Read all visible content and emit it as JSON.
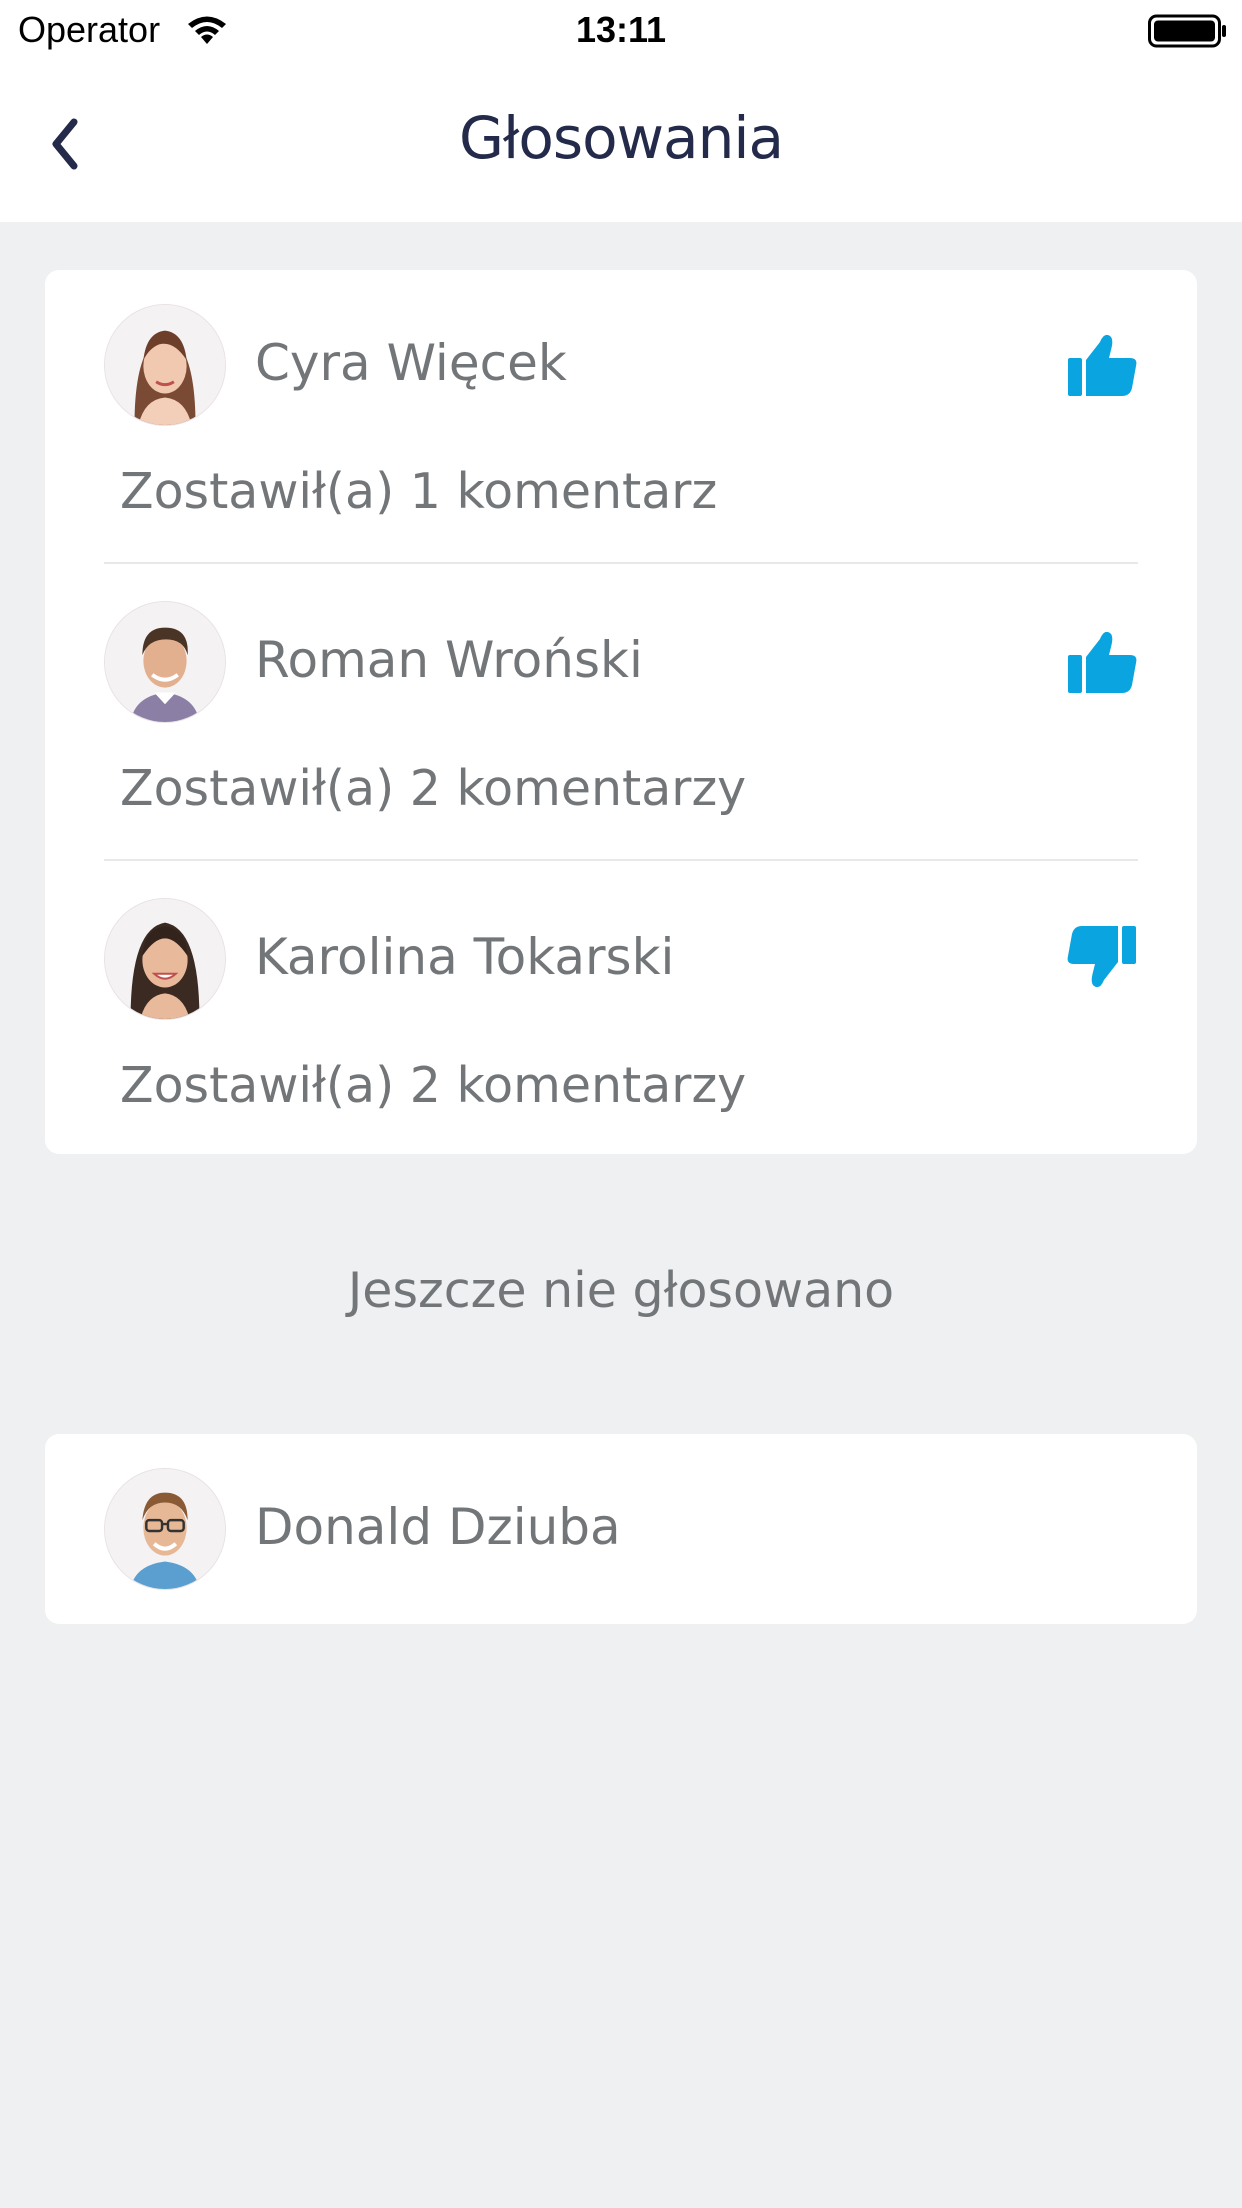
{
  "status_bar": {
    "carrier": "Operator",
    "time": "13:11"
  },
  "nav": {
    "title": "Głosowania"
  },
  "voted": [
    {
      "name": "Cyra Więcek",
      "comment": "Zostawił(a) 1 komentarz",
      "vote": "up",
      "avatar": "woman-long-hair"
    },
    {
      "name": "Roman Wroński",
      "comment": "Zostawił(a) 2 komentarzy",
      "vote": "up",
      "avatar": "man-short-hair"
    },
    {
      "name": "Karolina Tokarski",
      "comment": "Zostawił(a) 2 komentarzy",
      "vote": "down",
      "avatar": "woman-dark-hair"
    }
  ],
  "not_voted_label": "Jeszcze nie głosowano",
  "not_voted": [
    {
      "name": "Donald Dziuba",
      "avatar": "man-glasses"
    }
  ],
  "colors": {
    "accent": "#0aa5e0",
    "title": "#232a4a",
    "text": "#737679",
    "background": "#eef0f1"
  }
}
